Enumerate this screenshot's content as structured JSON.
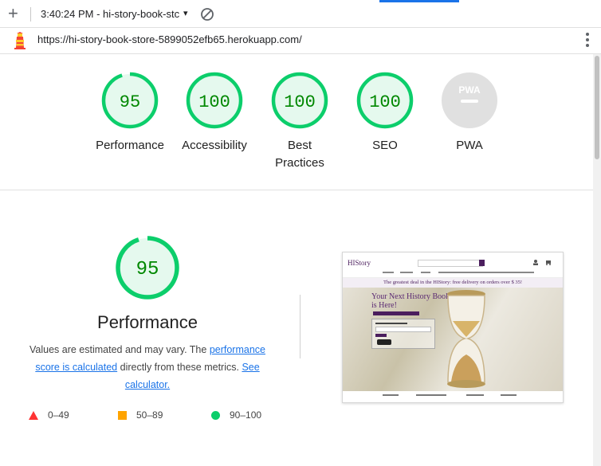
{
  "toolbar": {
    "new_tab_label": "+",
    "report_select": "3:40:24 PM - hi-story-book-stc",
    "dropdown_caret": "▾"
  },
  "url": "https://hi-story-book-store-5899052efb65.herokuapp.com/",
  "gauges": [
    {
      "label": "Performance",
      "score": "95",
      "value": 95
    },
    {
      "label": "Accessibility",
      "score": "100",
      "value": 100
    },
    {
      "label": "Best Practices",
      "score": "100",
      "value": 100
    },
    {
      "label": "SEO",
      "score": "100",
      "value": 100
    },
    {
      "label": "PWA",
      "score": "PWA",
      "value": null
    }
  ],
  "performance": {
    "score": "95",
    "value": 95,
    "title": "Performance",
    "desc_prefix": "Values are estimated and may vary. The ",
    "desc_link1": "performance score is calculated",
    "desc_middle": " directly from these metrics. ",
    "desc_link2": "See calculator."
  },
  "legend": {
    "fail": "0–49",
    "average": "50–89",
    "pass": "90–100"
  },
  "thumbnail": {
    "logo": "HIStory",
    "banner": "The greatest deal in the HIStory: free delivery on orders over $ 35!",
    "hero_title": "Your Next History Book is Here!"
  },
  "colors": {
    "pass": "#0cce6b",
    "pass_bg": "#e5f9ee",
    "pass_text": "#008800",
    "average": "#ffa400",
    "fail": "#ff3333",
    "link": "#1a73e8",
    "pwa_bg": "#e0e0e0"
  }
}
